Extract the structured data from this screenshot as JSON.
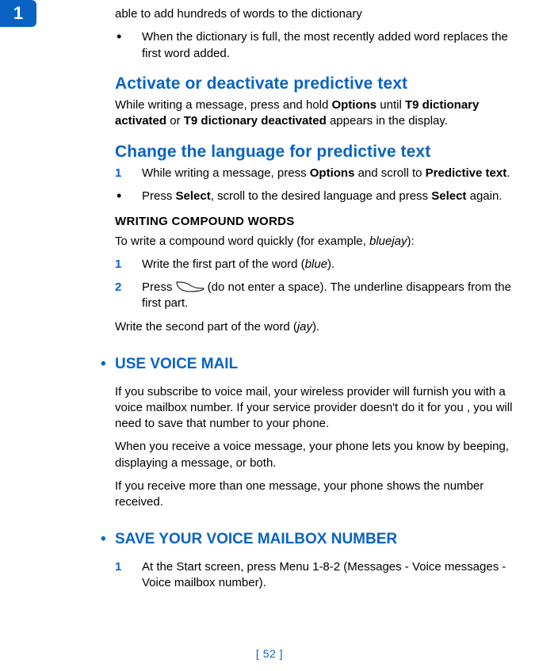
{
  "tab_number": "1",
  "top_fragment": "able to add hundreds of words to the dictionary",
  "bullet_full": {
    "pre": "When the dictionary is full, the most recently added word replaces the first word added."
  },
  "sec_activate": {
    "title": "Activate or deactivate predictive text",
    "body_parts": {
      "p1": "While writing a message, press and hold ",
      "b1": "Options",
      "p2": " until ",
      "b2": "T9 dictionary activated",
      "p3": " or ",
      "b3": "T9 dictionary deactivated",
      "p4": " appears in the display."
    }
  },
  "sec_change": {
    "title": "Change the language for predictive text",
    "steps": {
      "n1": "1",
      "s1": {
        "a": "While writing a message, press ",
        "b1": "Options",
        "b": " and scroll to ",
        "b2": "Predictive text",
        "c": "."
      },
      "s2": {
        "a": "Press ",
        "b1": "Select",
        "b": ", scroll to the desired language and press ",
        "b2": "Select",
        "c": " again."
      }
    }
  },
  "sec_compound": {
    "title": "WRITING COMPOUND WORDS",
    "intro": {
      "a": "To write a compound word quickly (for example, ",
      "i1": "bluejay",
      "b": "):"
    },
    "n1": "1",
    "step1": {
      "a": "Write the first part of the word (",
      "i1": "blue",
      "b": ")."
    },
    "n2": "2",
    "step2": {
      "a": "Press ",
      "b": " (do not enter a space). The underline disappears from the first part."
    },
    "after": {
      "a": "Write the second part of the word (",
      "i1": "jay",
      "b": ")."
    }
  },
  "sec_voice": {
    "title": "USE VOICE MAIL",
    "p1": "If you subscribe to voice mail, your wireless provider will furnish you with a voice mailbox number. If your service provider doesn't do it for you , you will need to save that number to your phone.",
    "p2": "When you receive a voice message, your phone lets you know by beeping, displaying a message, or both.",
    "p3": "If you receive more than one message, your phone shows the number received."
  },
  "sec_save": {
    "title": "SAVE YOUR VOICE MAILBOX NUMBER",
    "n1": "1",
    "step1": "At the Start screen, press Menu 1-8-2 (Messages - Voice messages - Voice mailbox number)."
  },
  "footer": "[ 52 ]"
}
